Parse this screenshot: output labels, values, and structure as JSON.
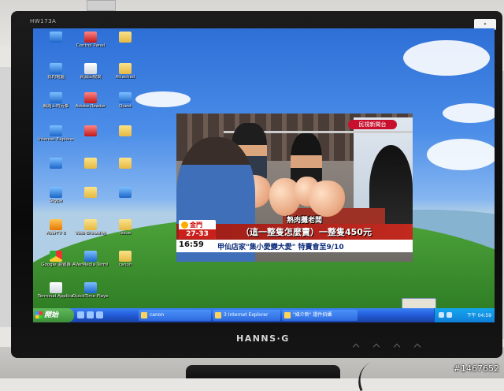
{
  "monitor": {
    "model": "HW173A",
    "brand": "HANNS·G",
    "watermark": "#1467652"
  },
  "desktop": {
    "icons": [
      {
        "label": "",
        "icon": "folder-icon",
        "style": "g-blue"
      },
      {
        "label": "Control Panel",
        "icon": "control-panel-icon",
        "style": "g-red"
      },
      {
        "label": "",
        "icon": "folder-icon",
        "style": "g-folder"
      },
      {
        "label": "我的電腦",
        "icon": "my-computer-icon",
        "style": "g-blue"
      },
      {
        "label": "資源回收筒",
        "icon": "recycle-bin-icon",
        "style": "g-white"
      },
      {
        "label": "Attached",
        "icon": "folder-icon",
        "style": "g-folder"
      },
      {
        "label": "網路上的芳鄰",
        "icon": "network-places-icon",
        "style": "g-blue"
      },
      {
        "label": "Adobe Reader",
        "icon": "adobe-reader-icon",
        "style": "g-red"
      },
      {
        "label": "Quest",
        "icon": "quest-icon",
        "style": "g-blue"
      },
      {
        "label": "Internet Explorer",
        "icon": "internet-explorer-icon",
        "style": "g-blue"
      },
      {
        "label": "",
        "icon": "app-icon",
        "style": "g-red"
      },
      {
        "label": "",
        "icon": "folder-icon",
        "style": "g-folder"
      },
      {
        "label": "",
        "icon": "app-icon",
        "style": "g-blue"
      },
      {
        "label": "",
        "icon": "folder-icon",
        "style": "g-folder"
      },
      {
        "label": "",
        "icon": "folder-icon",
        "style": "g-folder"
      },
      {
        "label": "Skype",
        "icon": "skype-icon",
        "style": "g-blue"
      },
      {
        "label": "",
        "icon": "folder-icon",
        "style": "g-folder"
      },
      {
        "label": "",
        "icon": "globe-icon",
        "style": "g-blue"
      },
      {
        "label": "AVerTV 6",
        "icon": "avertv-icon",
        "style": "g-orange"
      },
      {
        "label": "Web Browsing",
        "icon": "folder-icon",
        "style": "g-folder"
      },
      {
        "label": "Issue",
        "icon": "folder-icon",
        "style": "g-folder"
      },
      {
        "label": "Google 瀏覽器",
        "icon": "chrome-icon",
        "style": "g-chrome"
      },
      {
        "label": "AVerMedia Terminal",
        "icon": "avermedia-icon",
        "style": "g-blue"
      },
      {
        "label": "canon",
        "icon": "folder-icon",
        "style": "g-folder"
      },
      {
        "label": "Terminal Application",
        "icon": "terminal-icon",
        "style": "g-white"
      },
      {
        "label": "QuickTime Player",
        "icon": "quicktime-icon",
        "style": "g-blue"
      }
    ]
  },
  "tv": {
    "channel": "民視新聞台",
    "caption_top": "熟肉攤老闆",
    "banner": "（這一整隻怎麼賣）一整隻450元",
    "weather_city": "金門",
    "weather_temp": "27-33",
    "ticker_time": "16:59",
    "ticker_text": "甲仙店家\"集小愛變大愛\"  特賣會至9/10"
  },
  "taskbar": {
    "start_label": "開始",
    "tasks": [
      {
        "label": "canon"
      },
      {
        "label": "3 Internet Explorer"
      },
      {
        "label": "\"媒介新\" 證件拍攝"
      }
    ],
    "clock": "下午 04:59"
  },
  "colors": {
    "taskbar": "#245edb",
    "start": "#3c8f38",
    "tv_banner": "#c2291f"
  }
}
